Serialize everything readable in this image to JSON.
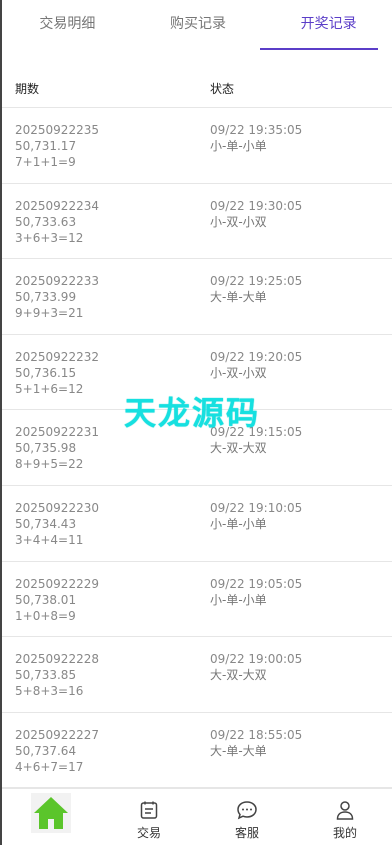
{
  "tabs": [
    {
      "label": "交易明细"
    },
    {
      "label": "购买记录"
    },
    {
      "label": "开奖记录"
    }
  ],
  "table": {
    "headers": [
      "期数",
      "状态"
    ],
    "rows": [
      {
        "period": "20250922235",
        "value": "50,731.17",
        "formula": "7+1+1=9",
        "time": "09/22 19:35:05",
        "status": "小-单-小单"
      },
      {
        "period": "20250922234",
        "value": "50,733.63",
        "formula": "3+6+3=12",
        "time": "09/22 19:30:05",
        "status": "小-双-小双"
      },
      {
        "period": "20250922233",
        "value": "50,733.99",
        "formula": "9+9+3=21",
        "time": "09/22 19:25:05",
        "status": "大-单-大单"
      },
      {
        "period": "20250922232",
        "value": "50,736.15",
        "formula": "5+1+6=12",
        "time": "09/22 19:20:05",
        "status": "小-双-小双"
      },
      {
        "period": "20250922231",
        "value": "50,735.98",
        "formula": "8+9+5=22",
        "time": "09/22 19:15:05",
        "status": "大-双-大双"
      },
      {
        "period": "20250922230",
        "value": "50,734.43",
        "formula": "3+4+4=11",
        "time": "09/22 19:10:05",
        "status": "小-单-小单"
      },
      {
        "period": "20250922229",
        "value": "50,738.01",
        "formula": "1+0+8=9",
        "time": "09/22 19:05:05",
        "status": "小-单-小单"
      },
      {
        "period": "20250922228",
        "value": "50,733.85",
        "formula": "5+8+3=16",
        "time": "09/22 19:00:05",
        "status": "大-双-大双"
      },
      {
        "period": "20250922227",
        "value": "50,737.64",
        "formula": "4+6+7=17",
        "time": "09/22 18:55:05",
        "status": "大-单-大单"
      }
    ]
  },
  "watermark": "天龙源码",
  "nav": [
    {
      "label": "",
      "icon": "home-icon"
    },
    {
      "label": "交易",
      "icon": "document-icon"
    },
    {
      "label": "客服",
      "icon": "chat-icon"
    },
    {
      "label": "我的",
      "icon": "user-icon"
    }
  ],
  "colors": {
    "accent": "#5b3ec8",
    "home": "#5bc52b",
    "watermark": "#16e0e0"
  }
}
